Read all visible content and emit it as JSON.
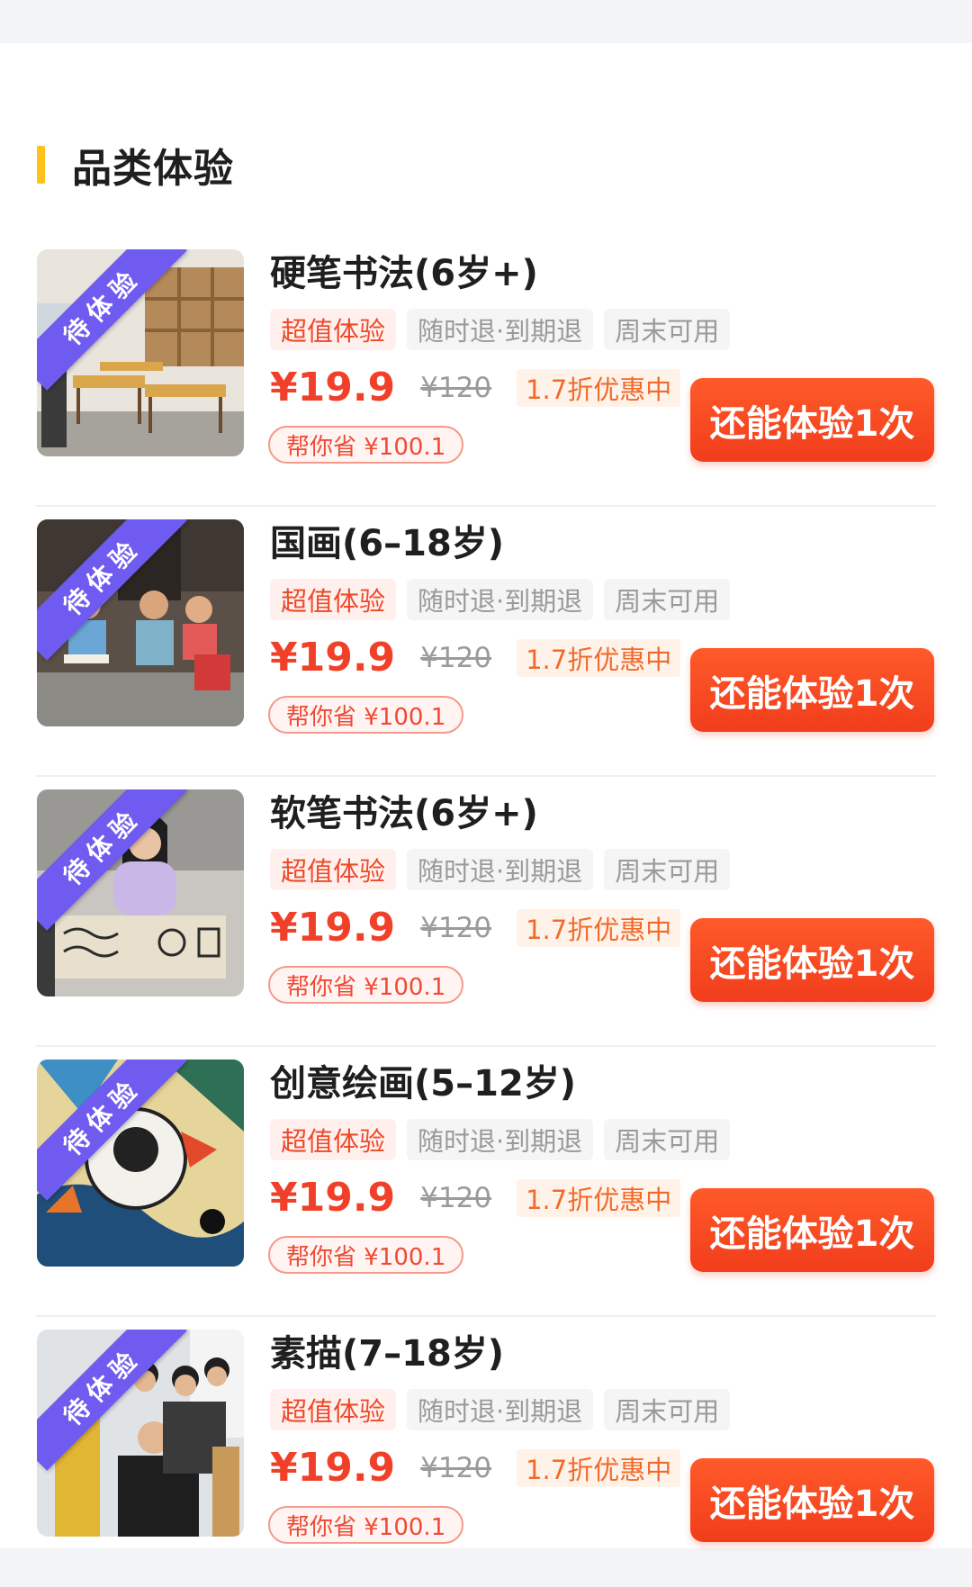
{
  "section": {
    "title": "品类体验"
  },
  "colors": {
    "accent": "#f13d1c",
    "ribbon": "#6f5bf0",
    "section_bar": "#ffc21a"
  },
  "items": [
    {
      "ribbon": "待体验",
      "title": "硬笔书法(6岁+)",
      "tags": [
        "超值体验",
        "随时退·到期退",
        "周末可用"
      ],
      "price": "¥19.9",
      "original_price": "¥120",
      "discount": "1.7折优惠中",
      "save": "帮你省 ¥100.1",
      "button": "还能体验1次",
      "image_icon": "classroom-photo"
    },
    {
      "ribbon": "待体验",
      "title": "国画(6–18岁)",
      "tags": [
        "超值体验",
        "随时退·到期退",
        "周末可用"
      ],
      "price": "¥19.9",
      "original_price": "¥120",
      "discount": "1.7折优惠中",
      "save": "帮你省 ¥100.1",
      "button": "还能体验1次",
      "image_icon": "children-painting-photo"
    },
    {
      "ribbon": "待体验",
      "title": "软笔书法(6岁+)",
      "tags": [
        "超值体验",
        "随时退·到期退",
        "周末可用"
      ],
      "price": "¥19.9",
      "original_price": "¥120",
      "discount": "1.7折优惠中",
      "save": "帮你省 ¥100.1",
      "button": "还能体验1次",
      "image_icon": "brush-calligraphy-photo"
    },
    {
      "ribbon": "待体验",
      "title": "创意绘画(5–12岁)",
      "tags": [
        "超值体验",
        "随时退·到期退",
        "周末可用"
      ],
      "price": "¥19.9",
      "original_price": "¥120",
      "discount": "1.7折优惠中",
      "save": "帮你省 ¥100.1",
      "button": "还能体验1次",
      "image_icon": "astronaut-artwork-photo"
    },
    {
      "ribbon": "待体验",
      "title": "素描(7–18岁)",
      "tags": [
        "超值体验",
        "随时退·到期退",
        "周末可用"
      ],
      "price": "¥19.9",
      "original_price": "¥120",
      "discount": "1.7折优惠中",
      "save": "帮你省 ¥100.1",
      "button": "还能体验1次",
      "image_icon": "sketch-class-photo"
    }
  ]
}
